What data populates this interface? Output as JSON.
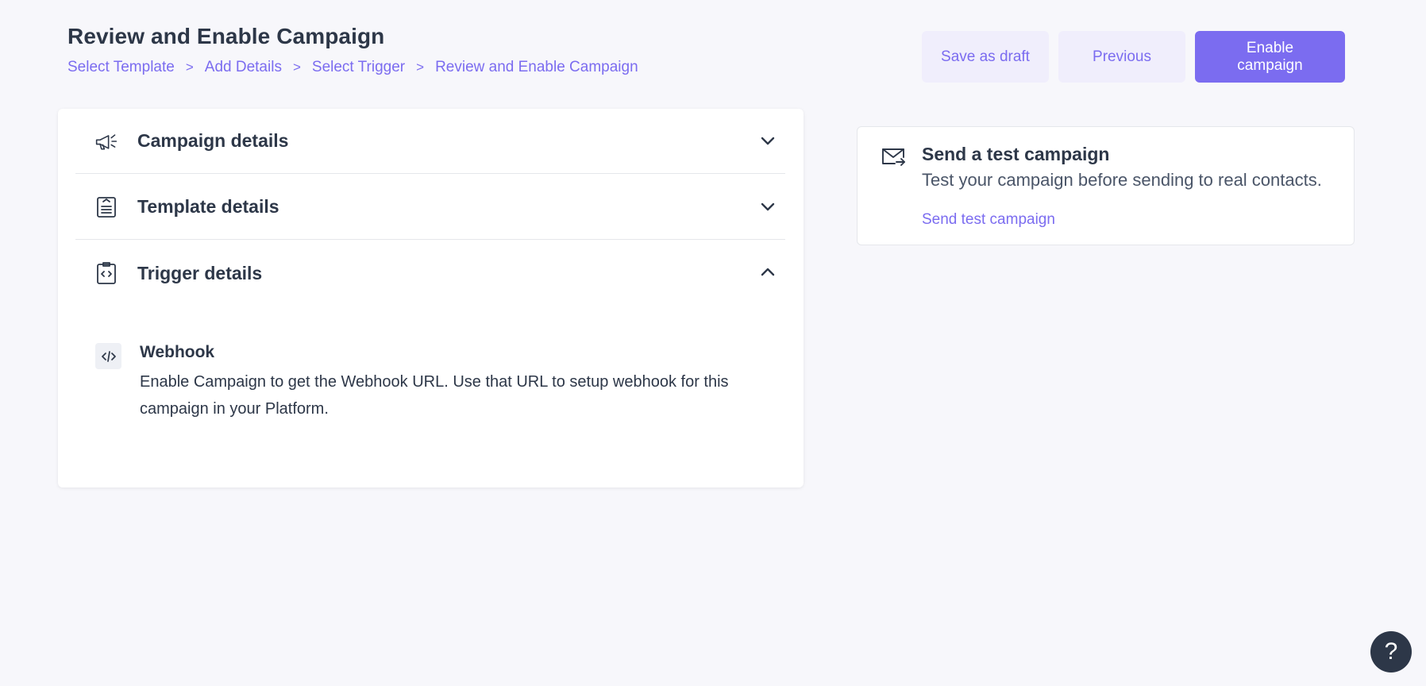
{
  "header": {
    "title": "Review and Enable Campaign",
    "breadcrumb": [
      {
        "label": "Select Template"
      },
      {
        "label": "Add Details"
      },
      {
        "label": "Select Trigger"
      },
      {
        "label": "Review and Enable Campaign"
      }
    ],
    "separator": ">",
    "actions": {
      "save_draft": "Save as draft",
      "previous": "Previous",
      "enable": "Enable campaign"
    }
  },
  "accordion": {
    "items": [
      {
        "label": "Campaign details",
        "icon": "megaphone-icon",
        "expanded": false
      },
      {
        "label": "Template details",
        "icon": "template-icon",
        "expanded": false
      },
      {
        "label": "Trigger details",
        "icon": "code-clipboard-icon",
        "expanded": true
      }
    ],
    "trigger": {
      "type_icon": "code-icon",
      "title": "Webhook",
      "description": "Enable Campaign to get the Webhook URL. Use that URL to setup webhook for this campaign in your Platform."
    }
  },
  "test_campaign": {
    "icon": "mail-send-icon",
    "title": "Send a test campaign",
    "subtitle": "Test your campaign before sending to real contacts.",
    "link": "Send test campaign"
  },
  "help": {
    "label": "?"
  },
  "colors": {
    "accent": "#7b6cf0",
    "accent_light": "#f0eefc",
    "text_dark": "#2d3748",
    "background": "#f7f7fb"
  }
}
